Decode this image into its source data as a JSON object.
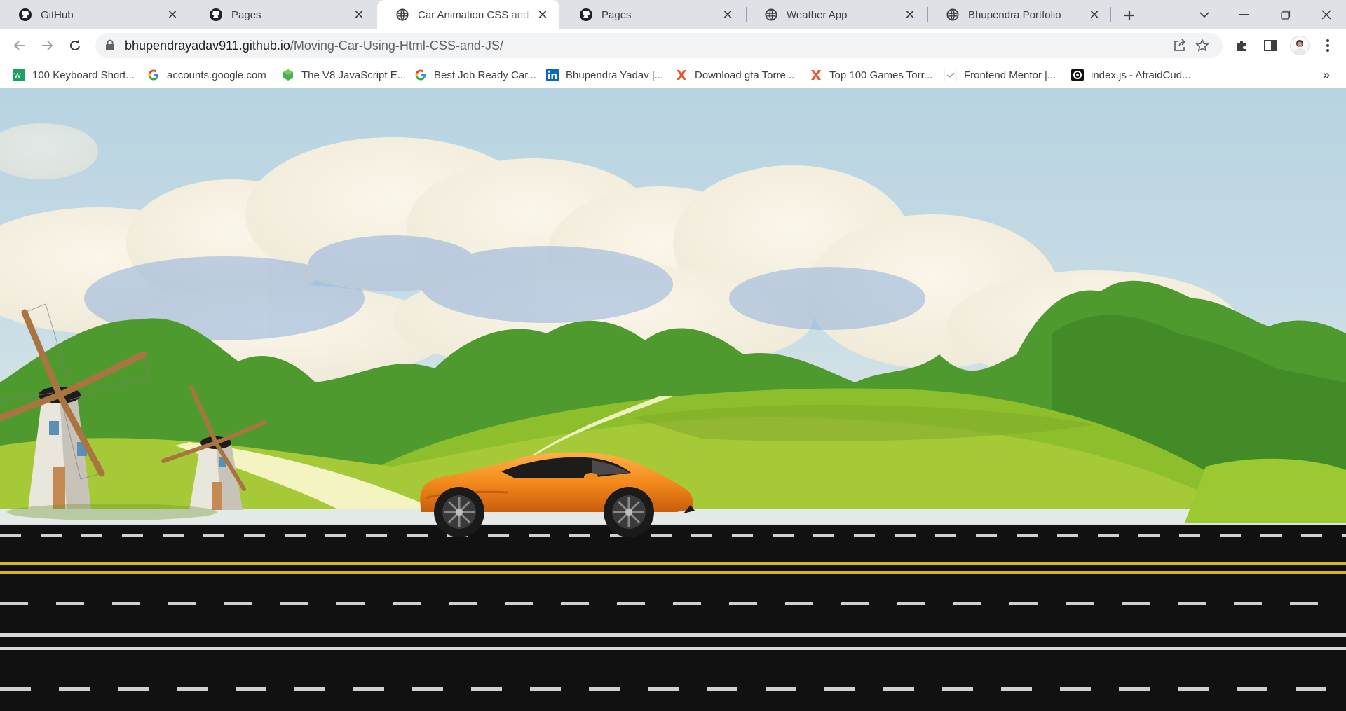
{
  "tabs": [
    {
      "title": "GitHub",
      "icon": "github-icon"
    },
    {
      "title": "Pages",
      "icon": "github-icon"
    },
    {
      "title": "Car Animation CSS and Java",
      "icon": "globe-icon",
      "active": true
    },
    {
      "title": "Pages",
      "icon": "github-icon"
    },
    {
      "title": "Weather App",
      "icon": "globe-icon"
    },
    {
      "title": "Bhupendra Portfolio",
      "icon": "globe-icon"
    }
  ],
  "address_bar": {
    "host": "bhupendrayadav911.github.io",
    "path": "/Moving-Car-Using-Html-CSS-and-JS/"
  },
  "bookmarks": [
    {
      "label": "100 Keyboard Short...",
      "icon": "bookmark-wn-icon",
      "color": "#1aa260"
    },
    {
      "label": "accounts.google.com",
      "icon": "google-icon",
      "color": "#4285f4"
    },
    {
      "label": "The V8 JavaScript E...",
      "icon": "v8-icon",
      "color": "#4caf50"
    },
    {
      "label": "Best Job Ready Car...",
      "icon": "google-icon",
      "color": "#4285f4"
    },
    {
      "label": "Bhupendra Yadav |...",
      "icon": "linkedin-icon",
      "color": "#0a66c2"
    },
    {
      "label": "Download gta Torre...",
      "icon": "torrent-x-icon",
      "color": "#e8542b"
    },
    {
      "label": "Top 100 Games Torr...",
      "icon": "torrent-x-icon",
      "color": "#e8542b"
    },
    {
      "label": "Frontend Mentor |...",
      "icon": "frontend-mentor-icon",
      "color": "#8f9ab5"
    },
    {
      "label": "index.js - AfraidCud...",
      "icon": "replit-icon",
      "color": "#111111"
    }
  ],
  "colors": {
    "sky": "#a9cbe0",
    "hill_light": "#a6c938",
    "forest": "#4f9a2e",
    "road": "#111111",
    "yellow_line": "#d9b526",
    "car": "#f48a1c"
  }
}
